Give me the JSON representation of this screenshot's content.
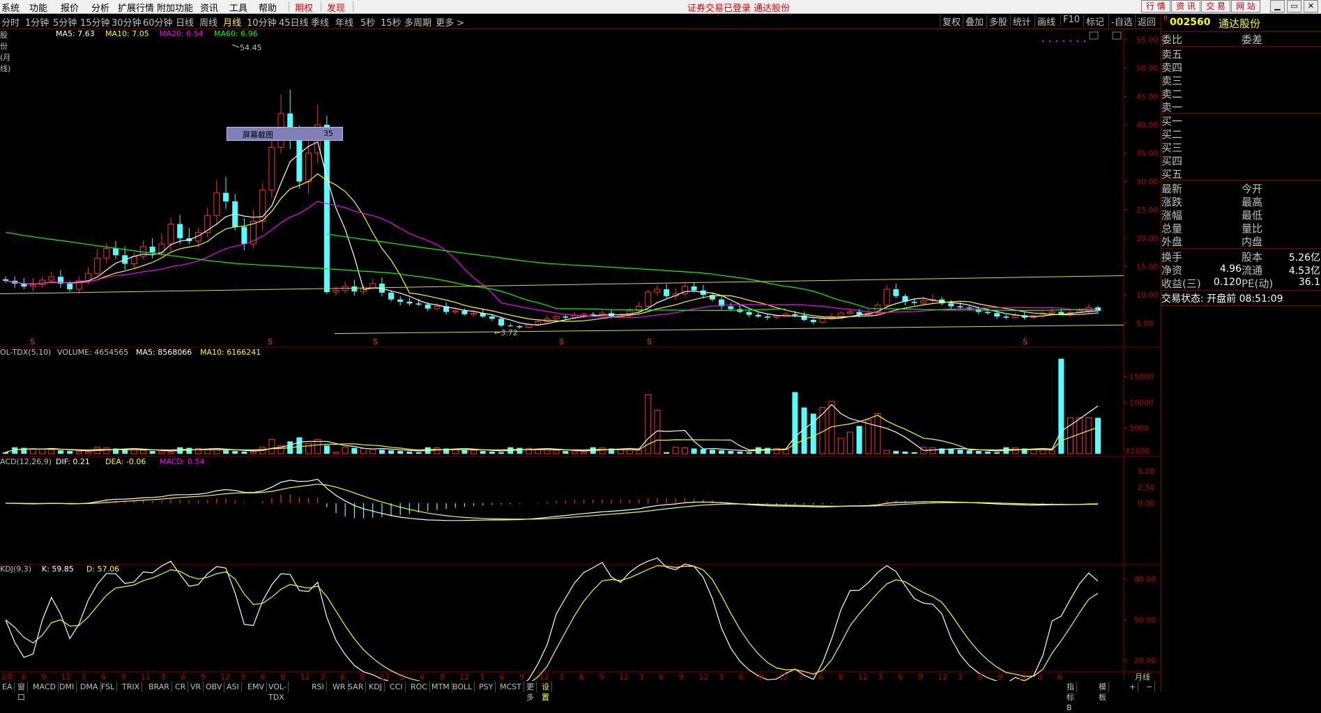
{
  "menubar": {
    "items": [
      "系统",
      "功能",
      "报价",
      "分析",
      "扩展行情",
      "附加功能",
      "资讯",
      "工具",
      "帮助"
    ],
    "tabs": [
      "期权",
      "发现"
    ],
    "status": "证券交易已登录  通达股份",
    "right_buttons": [
      "行 情",
      "资 讯",
      "交 易",
      "网 站"
    ]
  },
  "periods": [
    "分时",
    "1分钟",
    "5分钟",
    "15分钟",
    "30分钟",
    "60分钟",
    "日线",
    "周线",
    "月线",
    "10分钟",
    "45日线",
    "季线",
    "年线",
    "5秒",
    "15秒",
    "多周期",
    "更多 >"
  ],
  "active_period": "月线",
  "tools": [
    "复权",
    "叠加",
    "多股",
    "统计",
    "画线",
    "F10",
    "标记",
    "-自选",
    "返回"
  ],
  "price_panel": {
    "title": "股份(月线)",
    "ma": [
      {
        "label": "MA5: 7.63",
        "color": "#ffffff"
      },
      {
        "label": "MA10: 7.05",
        "color": "#ffff00"
      },
      {
        "label": "MA20: 6.54",
        "color": "#ff00ff"
      },
      {
        "label": "MA60: 6.96",
        "color": "#00ff00"
      }
    ],
    "high_mark": "54.45",
    "low_mark": "3.72",
    "y_ticks": [
      "55.00",
      "50.00",
      "45.00",
      "40.00",
      "35.00",
      "30.00",
      "25.00",
      "20.00",
      "15.00",
      "10.00",
      "5.00"
    ],
    "popup_label": "屏幕截图",
    "popup_value": "35"
  },
  "volume_panel": {
    "title": "OL-TDX(5,10)",
    "vals": [
      {
        "label": "VOLUME: 4654565",
        "color": "#c0c0c0"
      },
      {
        "label": "MA5: 8568066",
        "color": "#ffffff"
      },
      {
        "label": "MA10: 6166241",
        "color": "#ffff00"
      }
    ],
    "y_ticks": [
      "15000",
      "10000",
      "5000"
    ],
    "unit": "X1000"
  },
  "macd_panel": {
    "title": "ACD(12,26,9)",
    "vals": [
      {
        "label": "DIF: 0.21",
        "color": "#ffffff"
      },
      {
        "label": "DEA: -0.06",
        "color": "#ffff00"
      },
      {
        "label": "MACD: 0.54",
        "color": "#ff00ff"
      }
    ],
    "y_ticks": [
      "5.00",
      "2.50",
      "0.00"
    ]
  },
  "kdj_panel": {
    "title": "KDJ(9,3)",
    "vals": [
      {
        "label": "K: 59.85",
        "color": "#ffffff"
      },
      {
        "label": "D: 57.06",
        "color": "#ffff00"
      }
    ],
    "y_ticks": [
      "80.00",
      "50.00",
      "20.00"
    ]
  },
  "x_axis": {
    "labels": [
      "2年",
      "6",
      "9",
      "12",
      "3",
      "6",
      "9",
      "11",
      "3",
      "6",
      "9",
      "12",
      "3",
      "6",
      "9",
      "12",
      "3",
      "6",
      "9",
      "12",
      "3",
      "6",
      "9",
      "12",
      "3",
      "6",
      "9",
      "12",
      "3",
      "6",
      "9",
      "12",
      "3",
      "6",
      "9",
      "12",
      "3",
      "6",
      "9",
      "12",
      "3",
      "6",
      "9",
      "12",
      "3",
      "6",
      "9",
      "12",
      "3",
      "6",
      "9",
      "12",
      "3",
      "6"
    ],
    "period_label": "月线"
  },
  "bottom_tabs": [
    "EA",
    "窗口",
    "MACD",
    "DMI",
    "DMA",
    "FSL",
    "TRIX",
    "BRAR",
    "CR",
    "VR",
    "OBV",
    "ASI",
    "EMV",
    "VOL-TDX",
    "RSI",
    "WR",
    "SAR",
    "KDJ",
    "CCI",
    "ROC",
    "MTM",
    "BOLL",
    "PSY",
    "MCST",
    "更多",
    "设置"
  ],
  "bottom_right_tabs": [
    "指标B",
    "模 板",
    "+",
    "−"
  ],
  "info_panel": {
    "code": "002560",
    "name": "通达股份",
    "header": [
      "委比",
      "委差"
    ],
    "asks": [
      "卖五",
      "卖四",
      "卖三",
      "卖二",
      "卖一"
    ],
    "bids": [
      "买一",
      "买二",
      "买三",
      "买四",
      "买五"
    ],
    "quote_left": [
      "最新",
      "涨跌",
      "涨幅",
      "总量",
      "外盘"
    ],
    "quote_right": [
      "今开",
      "最高",
      "最低",
      "量比",
      "内盘"
    ],
    "fund_rows": [
      {
        "l": "换手",
        "v1": "",
        "m": "股本",
        "v2": "5.26亿"
      },
      {
        "l": "净资",
        "v1": "4.96",
        "m": "流通",
        "v2": "4.53亿"
      },
      {
        "l": "收益(三)",
        "v1": "0.120",
        "m": "PE(动)",
        "v2": "36.1"
      }
    ],
    "trade_status": "交易状态: 开盘前 08:51:09"
  },
  "chart_data": {
    "type": "candlestick",
    "note_close_series": [
      12.5,
      12.0,
      11.5,
      11.8,
      12.6,
      13.2,
      12.0,
      11.0,
      12.5,
      13.8,
      16.5,
      18.2,
      17.0,
      15.5,
      16.8,
      18.5,
      17.5,
      19.0,
      22.5,
      20.0,
      19.5,
      21.0,
      24.0,
      28.0,
      26.5,
      22.0,
      19.0,
      23.0,
      28.5,
      36.0,
      42.0,
      38.0,
      30.0,
      35.0,
      40.0,
      10.5,
      10.8,
      11.5,
      10.6,
      11.2,
      12.0,
      10.4,
      9.2,
      8.8,
      8.5,
      8.3,
      7.6,
      8.0,
      7.0,
      7.2,
      6.6,
      6.8,
      6.2,
      5.8,
      4.6,
      4.5,
      4.3,
      4.8,
      5.3,
      5.8,
      6.2,
      6.0,
      6.4,
      6.6,
      6.5,
      6.8,
      6.2,
      6.5,
      7.2,
      8.0,
      10.5,
      11.0,
      9.8,
      10.2,
      11.5,
      10.8,
      10.0,
      9.2,
      8.0,
      7.5,
      7.0,
      6.5,
      6.2,
      6.0,
      6.3,
      6.6,
      6.4,
      5.6,
      5.2,
      5.8,
      6.2,
      6.8,
      7.0,
      6.5,
      6.8,
      8.2,
      11.0,
      9.8,
      8.8,
      8.6,
      9.0,
      9.2,
      8.5,
      8.0,
      7.8,
      7.5,
      7.0,
      6.8,
      6.2,
      6.0,
      6.4,
      6.0,
      6.3,
      6.8,
      7.0,
      6.6,
      6.9,
      7.2,
      7.8,
      7.2
    ]
  }
}
